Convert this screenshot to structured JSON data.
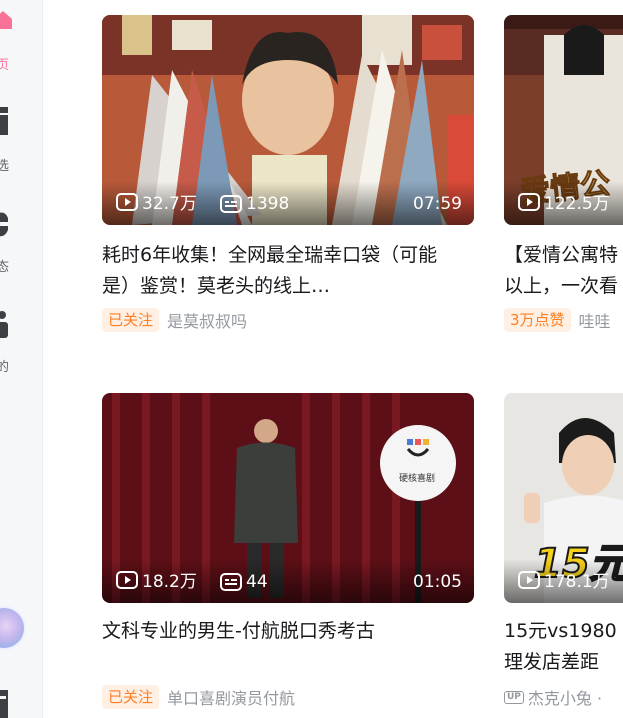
{
  "sidebar": {
    "items": [
      {
        "label": "页",
        "icon": "home-icon",
        "active": true
      },
      {
        "label": "选",
        "icon": "featured-icon",
        "active": false
      },
      {
        "label": "态",
        "icon": "dynamics-icon",
        "active": false
      },
      {
        "label": "的",
        "icon": "mine-icon",
        "active": false
      }
    ],
    "accent_color": "#fb7299"
  },
  "videos": [
    {
      "views": "32.7万",
      "comments": "1398",
      "duration": "07:59",
      "title": "耗时6年收集！全网最全瑞幸口袋（可能是）鉴赏！莫老头的线上…",
      "badge": "已关注",
      "author": "是莫叔叔吗"
    },
    {
      "views": "122.5万",
      "overlay_text": "爱情公",
      "title": "【爱情公寓特以上，一次看",
      "badge": "3万点赞",
      "author": "哇哇"
    },
    {
      "views": "18.2万",
      "comments": "44",
      "duration": "01:05",
      "sign_text": "硬核喜剧",
      "title": "文科专业的男生-付航脱口秀考古",
      "badge": "已关注",
      "author": "单口喜剧演员付航"
    },
    {
      "views": "178.1万",
      "overlay_text": "15元",
      "title": "15元vs1980理发店差距",
      "up_label": "UP",
      "author": "杰克小兔 ·"
    }
  ],
  "colors": {
    "badge_bg": "#fff0e3",
    "badge_text": "#ff7f24",
    "meta_text": "#9499a0"
  }
}
